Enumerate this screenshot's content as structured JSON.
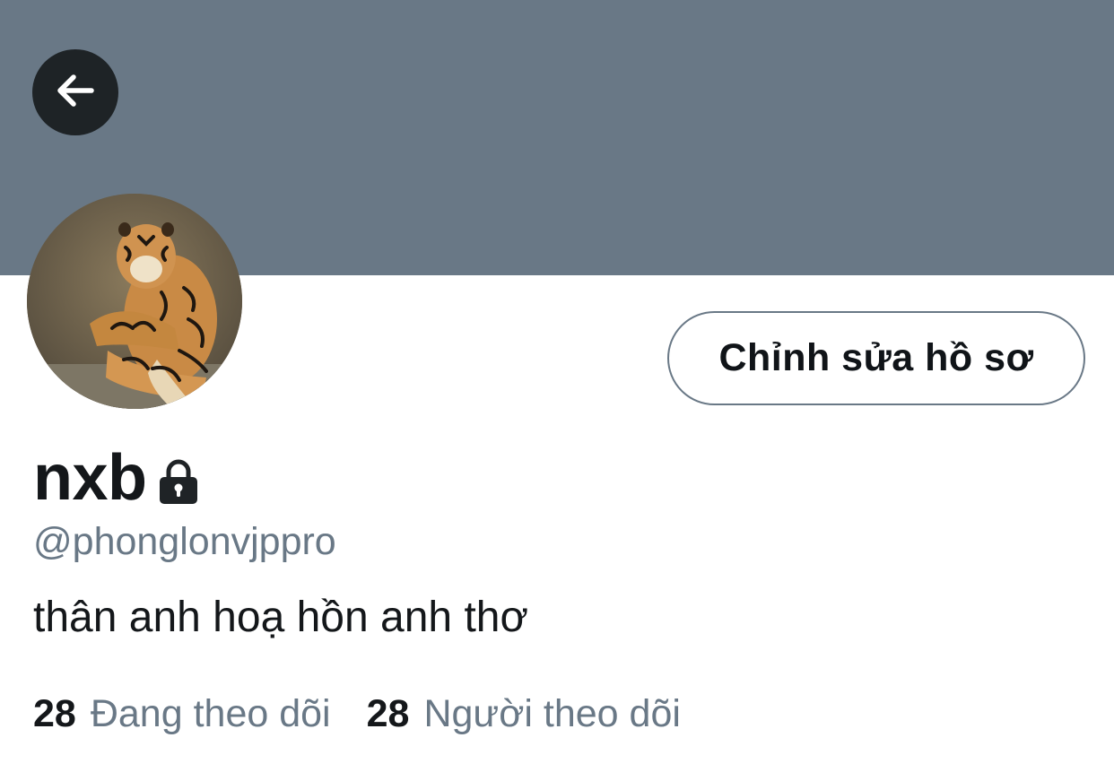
{
  "colors": {
    "banner": "#697886",
    "back_button_bg": "#1e2326",
    "text_primary": "#14171a",
    "text_secondary": "#697886",
    "button_border": "#697886"
  },
  "header": {
    "back_icon": "arrow-left-icon"
  },
  "profile": {
    "avatar_description_icon": "tiger-avatar",
    "edit_button_label": "Chỉnh sửa hồ sơ",
    "display_name": "nxb",
    "protected_icon": "lock-icon",
    "handle": "@phonglonvjppro",
    "bio": "thân anh hoạ hồn anh thơ"
  },
  "stats": {
    "following": {
      "count": "28",
      "label": "Đang theo dõi"
    },
    "followers": {
      "count": "28",
      "label": "Người theo dõi"
    }
  }
}
